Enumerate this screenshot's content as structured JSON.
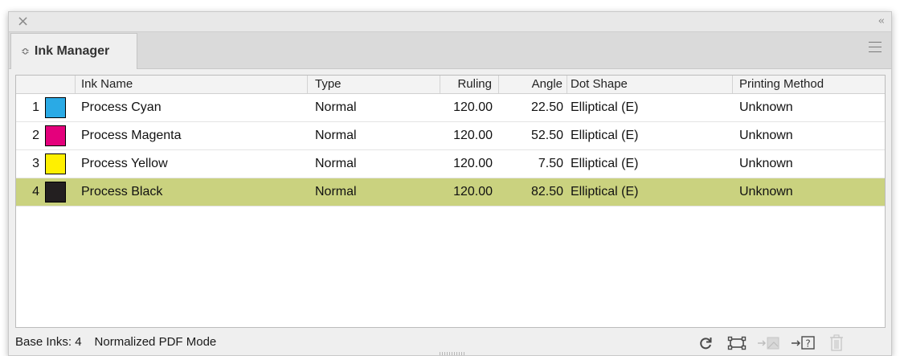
{
  "window": {
    "close_glyph": "×",
    "collapse_glyph": "‹‹"
  },
  "tab": {
    "label": "Ink Manager",
    "icon": "stepper-icon"
  },
  "table": {
    "headers": [
      "",
      "Ink Name",
      "Type",
      "Ruling",
      "Angle",
      "Dot Shape",
      "Printing Method"
    ],
    "rows": [
      {
        "index": "1",
        "color": "#2aaae5",
        "name": "Process Cyan",
        "type": "Normal",
        "ruling": "120.00",
        "angle": "22.50",
        "dot_shape": "Elliptical (E)",
        "method": "Unknown"
      },
      {
        "index": "2",
        "color": "#e4007c",
        "name": "Process Magenta",
        "type": "Normal",
        "ruling": "120.00",
        "angle": "52.50",
        "dot_shape": "Elliptical (E)",
        "method": "Unknown"
      },
      {
        "index": "3",
        "color": "#fff000",
        "name": "Process Yellow",
        "type": "Normal",
        "ruling": "120.00",
        "angle": "7.50",
        "dot_shape": "Elliptical (E)",
        "method": "Unknown"
      },
      {
        "index": "4",
        "color": "#231f20",
        "name": "Process Black",
        "type": "Normal",
        "ruling": "120.00",
        "angle": "82.50",
        "dot_shape": "Elliptical (E)",
        "method": "Unknown"
      }
    ],
    "selected_row_color": "#cad27f"
  },
  "status": {
    "base_inks": "Base Inks: 4",
    "mode": "Normalized PDF Mode"
  },
  "toolbar_icons": [
    "refresh-icon",
    "frame-icon",
    "import-ink-icon",
    "unknown-ink-icon",
    "trash-icon"
  ]
}
